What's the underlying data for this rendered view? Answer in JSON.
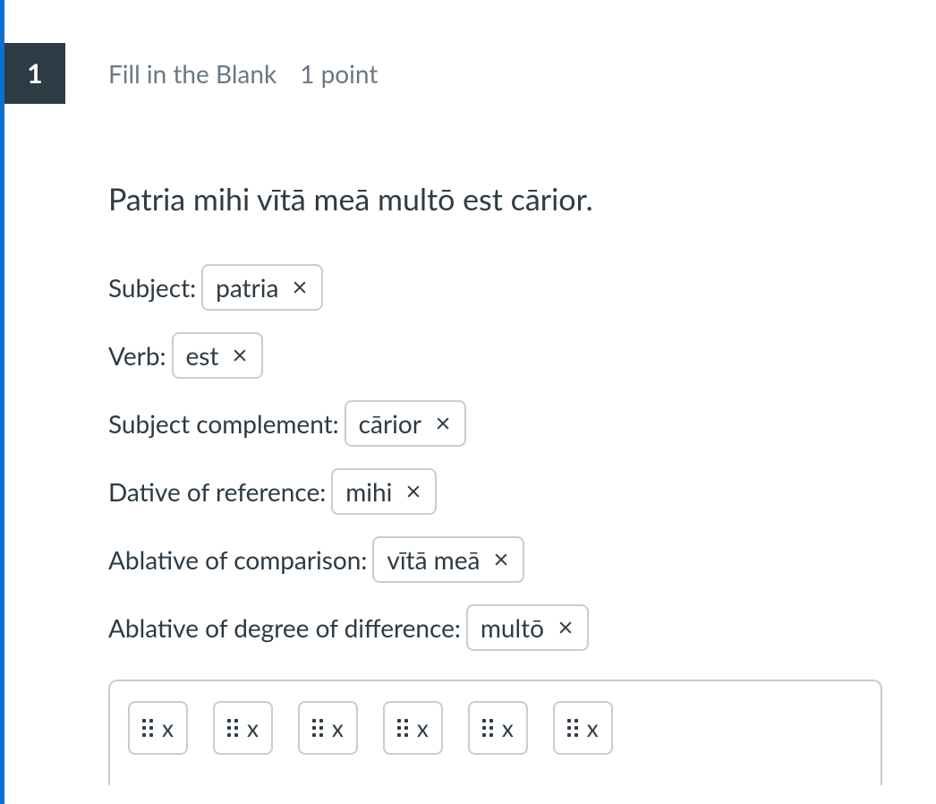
{
  "question": {
    "number": "1",
    "type": "Fill in the Blank",
    "points": "1 point",
    "prompt": "Patria mihi vītā meā multō est cārior."
  },
  "blanks": [
    {
      "label": "Subject:",
      "value": "patria"
    },
    {
      "label": "Verb:",
      "value": "est"
    },
    {
      "label": "Subject complement:",
      "value": "cārior"
    },
    {
      "label": "Dative of reference:",
      "value": "mihi"
    },
    {
      "label": "Ablative of comparison:",
      "value": "vītā meā"
    },
    {
      "label": "Ablative of degree of difference:",
      "value": "multō"
    }
  ],
  "tray": [
    {
      "label": "x"
    },
    {
      "label": "x"
    },
    {
      "label": "x"
    },
    {
      "label": "x"
    },
    {
      "label": "x"
    },
    {
      "label": "x"
    }
  ]
}
